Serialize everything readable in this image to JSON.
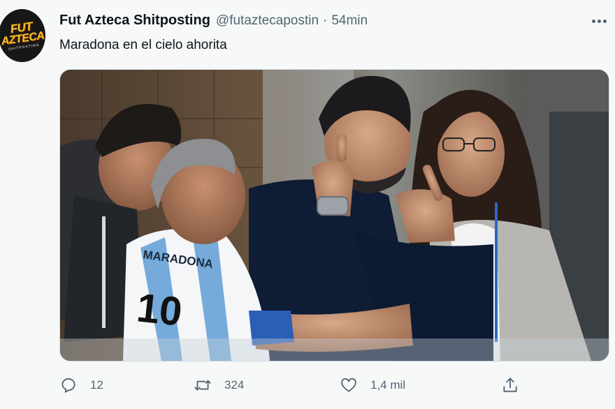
{
  "author": {
    "display_name": "Fut Azteca Shitposting",
    "handle": "@futaztecapostin",
    "separator": "·",
    "time": "54min",
    "avatar": {
      "line1": "FUT",
      "line2": "AZTECA",
      "line3": "SHITPOSTING"
    }
  },
  "tweet": {
    "text": "Maradona en el cielo ahorita"
  },
  "media": {
    "jersey_text": "MARADONA",
    "jersey_number": "10"
  },
  "actions": {
    "replies": "12",
    "retweets": "324",
    "likes": "1,4 mil"
  },
  "colors": {
    "background": "#f7f9f9",
    "text_primary": "#0f1419",
    "text_secondary": "#536471",
    "argentina_blue": "#75aadb"
  },
  "icons": {
    "more": "more-dots-icon",
    "reply": "reply-bubble-icon",
    "retweet": "retweet-arrows-icon",
    "like": "heart-icon",
    "share": "share-upload-icon"
  }
}
